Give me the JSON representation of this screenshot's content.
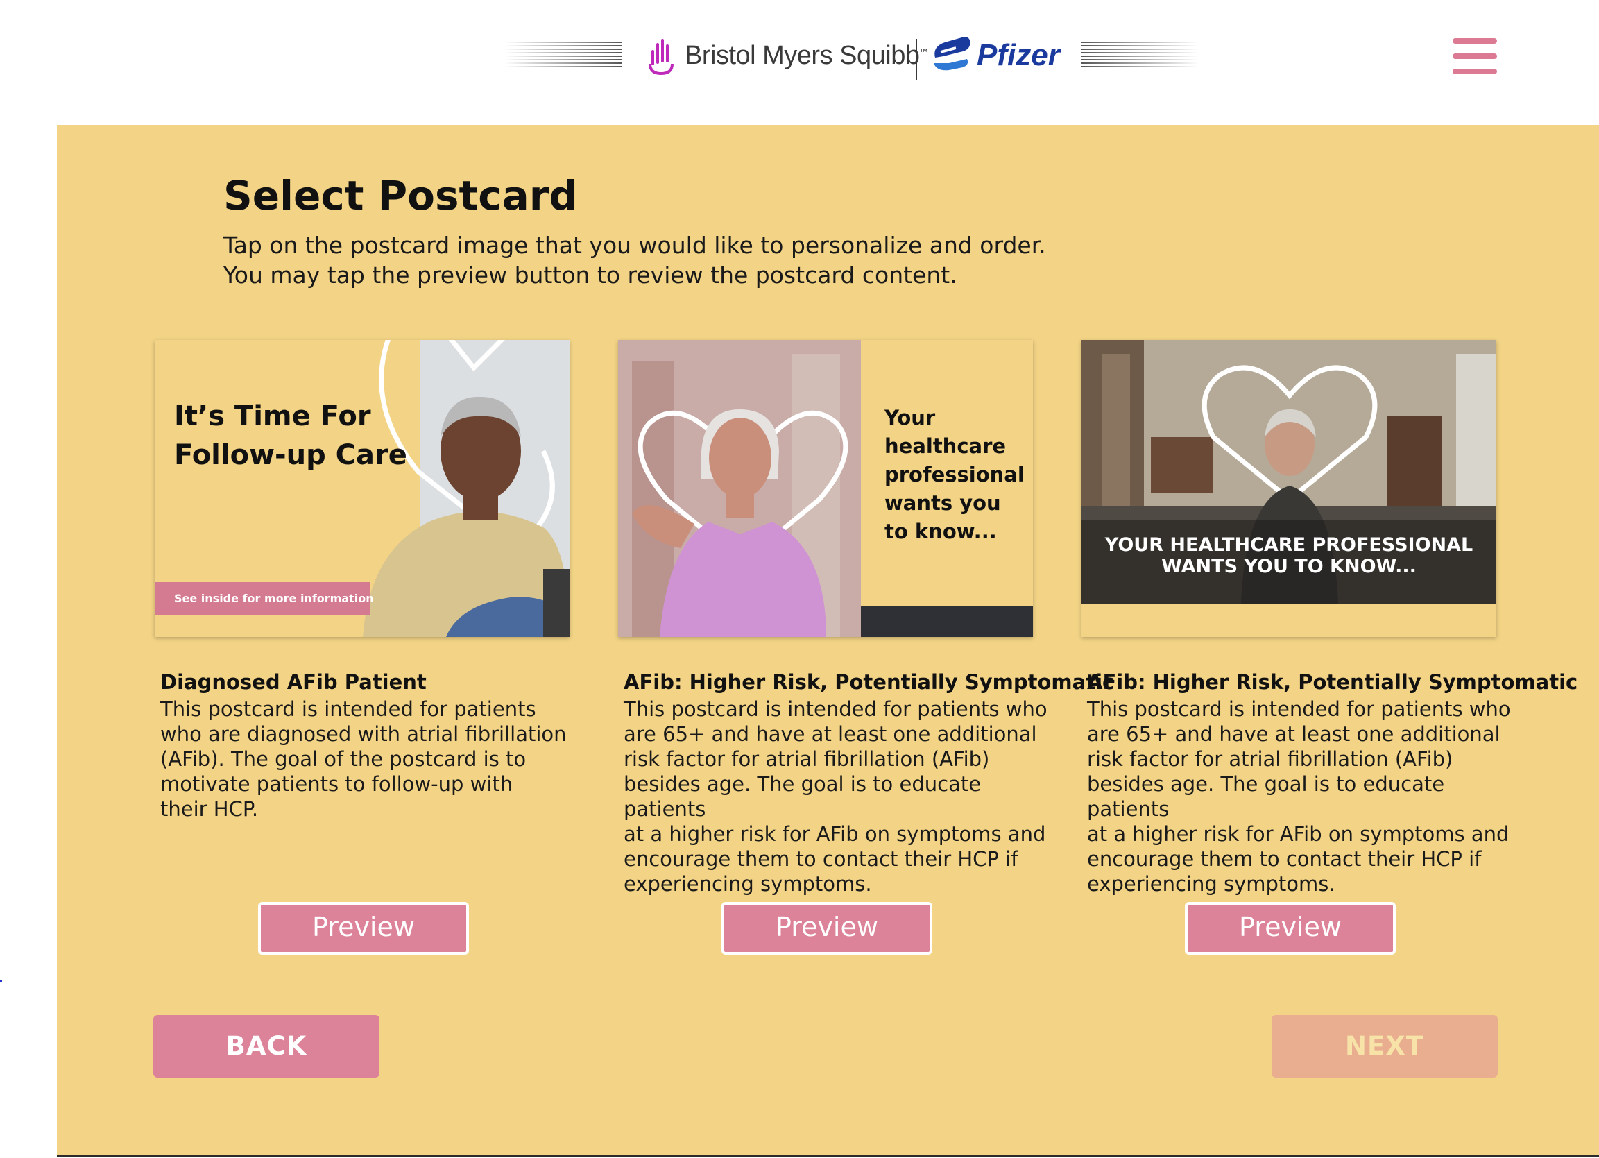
{
  "header": {
    "bms_logo_text": "Bristol Myers Squibb",
    "bms_trademark": "™",
    "pfizer_logo_text": "Pfizer",
    "menu_icon": "hamburger-menu-icon",
    "brand_pink": "#dc7a93"
  },
  "page": {
    "title": "Select Postcard",
    "instructions": [
      "Tap on the postcard image that you would like to personalize and order.",
      "You may tap the preview button to review the postcard content."
    ],
    "background": "#f3d486"
  },
  "postcards": [
    {
      "image_headline": "It’s Time For\nFollow-up Care",
      "image_banner": "See inside for more information",
      "label": "Diagnosed AFib Patient",
      "description": "This postcard is intended for patients\nwho are diagnosed with atrial fibrillation\n(AFib). The goal of the postcard is to\nmotivate patients to follow-up with\ntheir HCP.",
      "preview_label": "Preview"
    },
    {
      "image_headline": "Your\nhealthcare\nprofessional\nwants you\nto know...",
      "label": "AFib: Higher Risk, Potentially Symptomatic",
      "description": "This postcard is intended for patients who\nare 65+ and have at least one additional\nrisk factor for atrial fibrillation (AFib)\nbesides age. The goal is to educate patients\nat a higher risk for AFib on symptoms and\nencourage them to contact their HCP if\nexperiencing symptoms.",
      "preview_label": "Preview"
    },
    {
      "image_headline": "YOUR HEALTHCARE PROFESSIONAL\nWANTS YOU TO KNOW...",
      "label": "AFib: Higher Risk, Potentially Symptomatic",
      "description": "This postcard is intended for patients who\nare 65+ and have at least one additional\nrisk factor for atrial fibrillation (AFib)\nbesides age. The goal is to educate patients\nat a higher risk for AFib on symptoms and\nencourage them to contact their HCP if\nexperiencing symptoms.",
      "preview_label": "Preview"
    }
  ],
  "navigation": {
    "back_label": "BACK",
    "next_label": "NEXT",
    "next_enabled": false
  }
}
